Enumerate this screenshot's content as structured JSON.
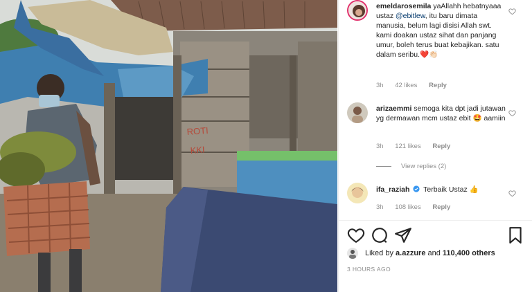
{
  "post": {
    "photo_alt_icon": "photo"
  },
  "comments": [
    {
      "username": "emeldarosemila",
      "text_before": "yaAllahh hebatnyaaa ustaz ",
      "mention": "@ebitlew",
      "text_after": ", itu baru dimata manusia, belum lagi disisi Allah swt. kami doakan ustaz sihat dan panjang umur, boleh terus buat kebajikan. satu dalam seribu.",
      "emoji": "❤️👏🏻",
      "time": "3h",
      "likes": "42 likes",
      "reply": "Reply"
    },
    {
      "username": "arizaemmi",
      "text": "semoga kita dpt jadi jutawan yg dermawan mcm ustaz ebit",
      "emoji": "🤩",
      "text_after": " aamiin",
      "time": "3h",
      "likes": "121 likes",
      "reply": "Reply",
      "view_replies": "View replies (2)"
    },
    {
      "username": "ifa_raziah",
      "verified": true,
      "text": "Terbaik Ustaz",
      "emoji": "👍",
      "time": "3h",
      "likes": "108 likes",
      "reply": "Reply"
    }
  ],
  "liked_by": {
    "prefix": "Liked by ",
    "user": "a.azzure",
    "middle": " and ",
    "count": "110,400 others"
  },
  "timestamp": "3 HOURS AGO",
  "colors": {
    "text": "#262626",
    "meta": "#8e8e8e",
    "mention": "#00376b",
    "verified": "#3897f0"
  }
}
